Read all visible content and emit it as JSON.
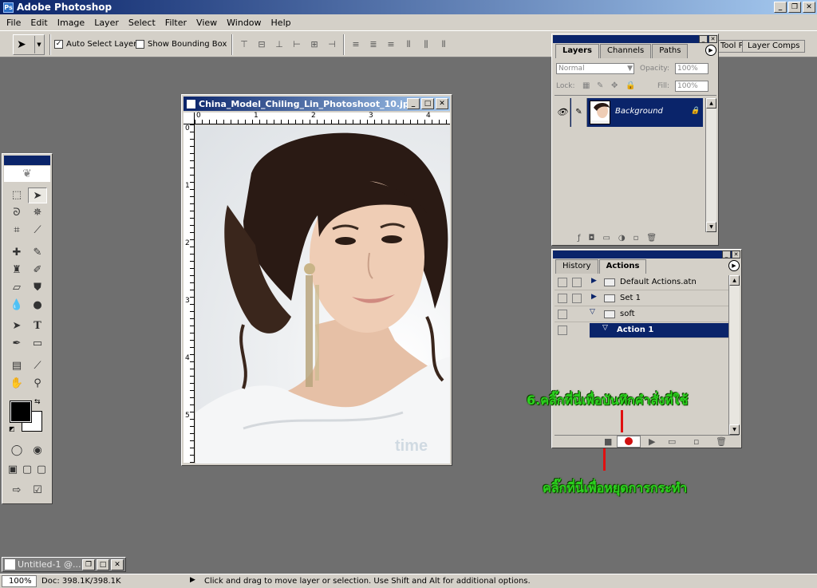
{
  "app": {
    "title": "Adobe Photoshop"
  },
  "menu": [
    "File",
    "Edit",
    "Image",
    "Layer",
    "Select",
    "Filter",
    "View",
    "Window",
    "Help"
  ],
  "options": {
    "auto_select": "Auto Select Layer",
    "show_bounding": "Show Bounding Box",
    "well_tabs": [
      "Tool Pr",
      "Layer Comps"
    ]
  },
  "document": {
    "title": "China_Model_Chiling_Lin_Photoshoot_10.jp...",
    "ruler_h": [
      "0",
      "1",
      "2",
      "3",
      "4"
    ],
    "ruler_v": [
      "0",
      "1",
      "2",
      "3",
      "4",
      "5"
    ],
    "watermark": "time"
  },
  "layers_palette": {
    "tabs": [
      "Layers",
      "Channels",
      "Paths"
    ],
    "blend_mode": "Normal",
    "opacity_label": "Opacity:",
    "opacity": "100%",
    "lock_label": "Lock:",
    "fill_label": "Fill:",
    "fill": "100%",
    "layer_name": "Background"
  },
  "actions_palette": {
    "tabs": [
      "History",
      "Actions"
    ],
    "rows": [
      "Default Actions.atn",
      "Set 1",
      "soft",
      "Action 1"
    ]
  },
  "annotations": {
    "record": "6.คลิ๊กที่นี่เพื่อบันทึกคำสั่งที่ใช้",
    "stop": "คลิ๊กที่นี่เพื่อหยุดการกระทำ"
  },
  "minimized_doc": {
    "title": "Untitled-1 @..."
  },
  "status": {
    "zoom": "100%",
    "doc": "Doc: 398.1K/398.1K",
    "hint": "Click and drag to move layer or selection.  Use Shift and Alt for additional options."
  },
  "colors": {
    "titlebar": "#0a246a",
    "workspace": "#6f6f6f",
    "annotation": "#2bd21f",
    "record": "#d01010"
  }
}
